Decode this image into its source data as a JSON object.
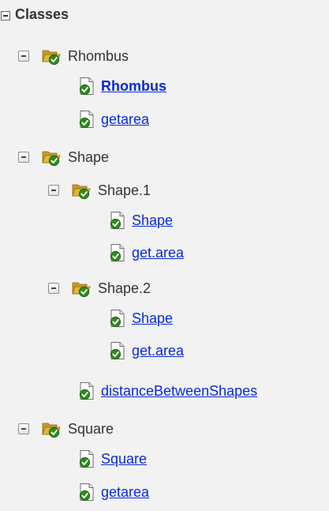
{
  "tree": {
    "root_label": "Classes",
    "nodes": [
      {
        "type": "folder",
        "label": "Rhombus"
      },
      {
        "type": "file",
        "label": "Rhombus",
        "bold": true
      },
      {
        "type": "file",
        "label": "getarea"
      },
      {
        "type": "folder",
        "label": "Shape"
      },
      {
        "type": "folder",
        "label": "Shape.1"
      },
      {
        "type": "file",
        "label": "Shape"
      },
      {
        "type": "file",
        "label": "get.area"
      },
      {
        "type": "folder",
        "label": "Shape.2"
      },
      {
        "type": "file",
        "label": "Shape"
      },
      {
        "type": "file",
        "label": "get.area"
      },
      {
        "type": "file",
        "label": "distanceBetweenShapes"
      },
      {
        "type": "folder",
        "label": "Square"
      },
      {
        "type": "file",
        "label": "Square"
      },
      {
        "type": "file",
        "label": "getarea"
      }
    ]
  },
  "icons": {
    "folder": "folder-open-check-icon",
    "file": "file-check-icon",
    "toggle": "minus-box-icon"
  },
  "colors": {
    "link": "#0a2ad6",
    "folder": "#e2b936",
    "check": "#2e8b1e",
    "background": "#f2f2f2"
  }
}
